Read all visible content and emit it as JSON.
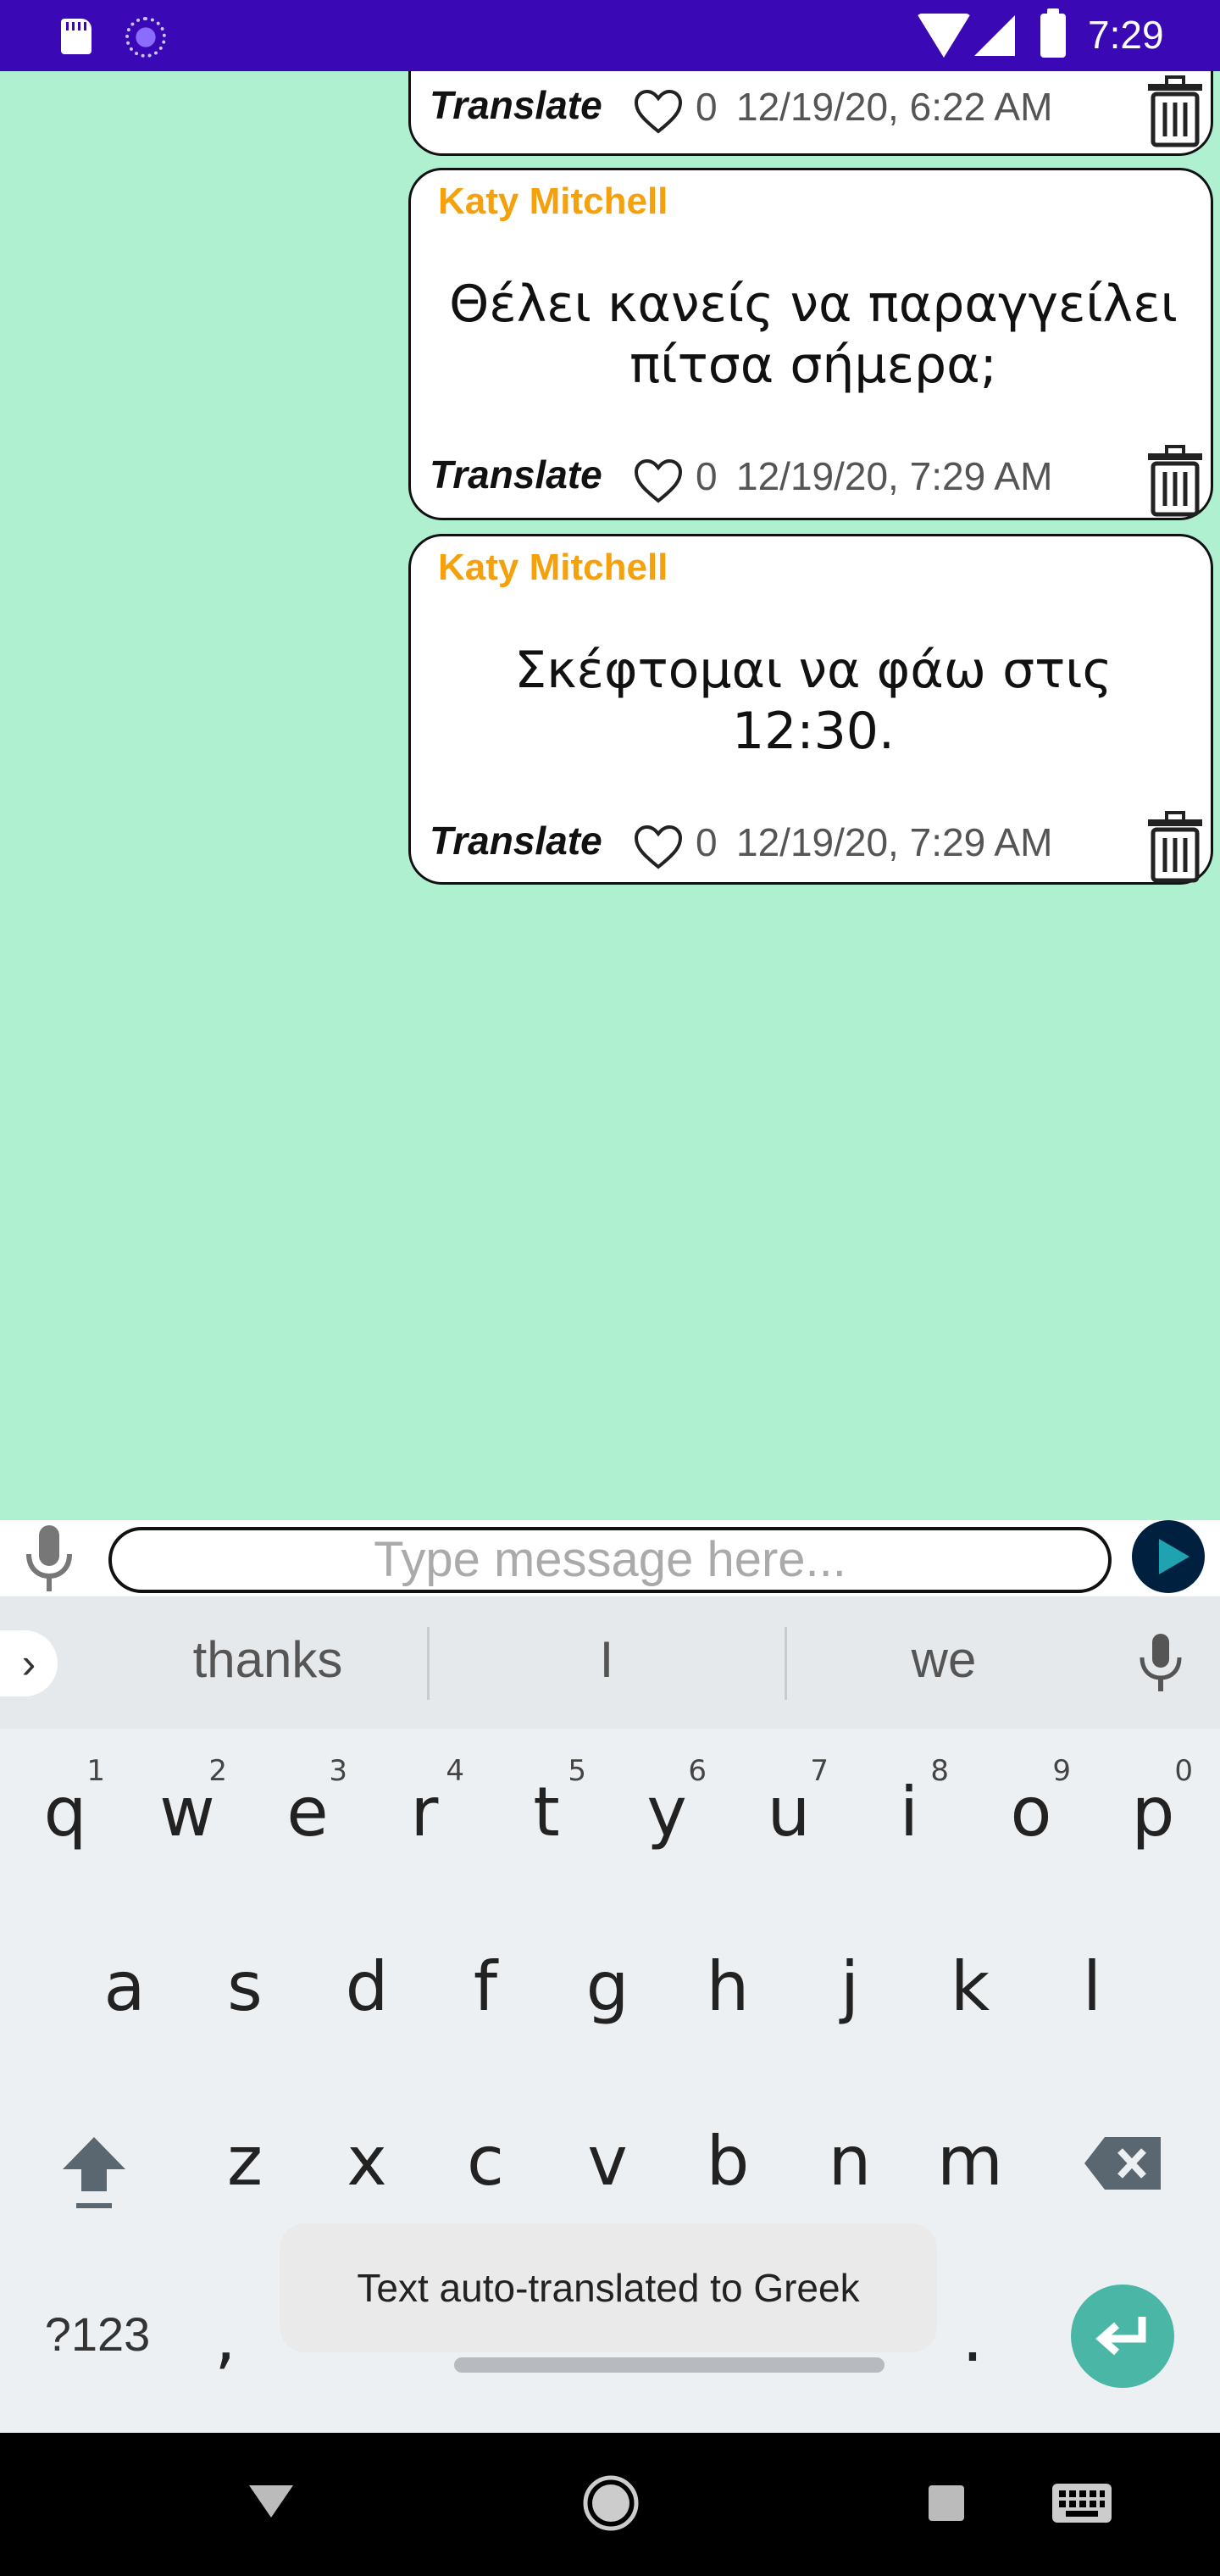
{
  "status_bar": {
    "time": "7:29"
  },
  "messages": [
    {
      "sender": "",
      "text": "",
      "translate_label": "Translate",
      "likes": "0",
      "timestamp": "12/19/20, 6:22 AM"
    },
    {
      "sender": "Katy Mitchell",
      "text": "Θέλει κανείς να παραγγείλει πίτσα σήμερα;",
      "translate_label": "Translate",
      "likes": "0",
      "timestamp": "12/19/20, 7:29 AM"
    },
    {
      "sender": "Katy Mitchell",
      "text": "Σκέφτομαι να φάω στις 12:30.",
      "translate_label": "Translate",
      "likes": "0",
      "timestamp": "12/19/20, 7:29 AM"
    }
  ],
  "composer": {
    "placeholder": "Type message here..."
  },
  "keyboard": {
    "suggestions": [
      "thanks",
      "I",
      "we"
    ],
    "row1": [
      "q",
      "w",
      "e",
      "r",
      "t",
      "y",
      "u",
      "i",
      "o",
      "p"
    ],
    "row1_hints": [
      "1",
      "2",
      "3",
      "4",
      "5",
      "6",
      "7",
      "8",
      "9",
      "0"
    ],
    "row2": [
      "a",
      "s",
      "d",
      "f",
      "g",
      "h",
      "j",
      "k",
      "l"
    ],
    "row3": [
      "z",
      "x",
      "c",
      "v",
      "b",
      "n",
      "m"
    ],
    "symbols_label": "?123",
    "comma": ",",
    "period": "."
  },
  "toast": "Text auto-translated to Greek",
  "colors": {
    "status_bar": "#3a08b5",
    "chat_bg": "#aef0d0",
    "wave": "#00203f",
    "sender": "#f5a10e",
    "enter": "#4ab6a6"
  }
}
